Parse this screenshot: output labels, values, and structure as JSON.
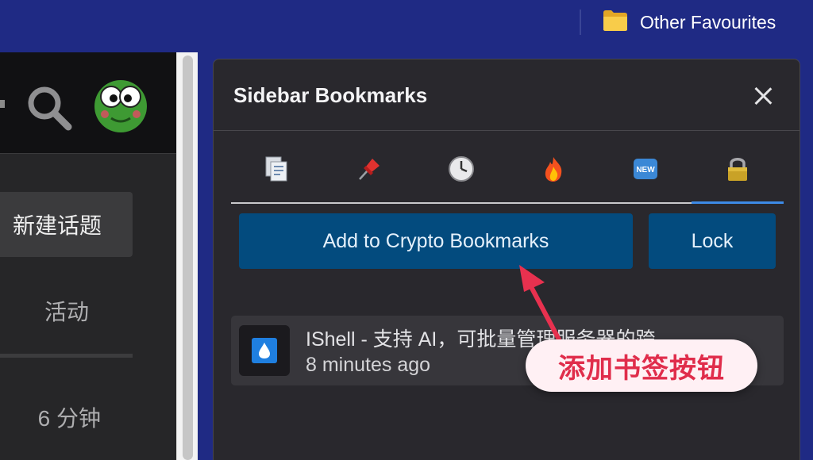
{
  "browser": {
    "favourites_bar": {
      "folder_label": "Other Favourites",
      "folder_icon": "folder-icon"
    }
  },
  "forum": {
    "header": {
      "search_icon": "search-icon",
      "avatar_icon": "frog-avatar"
    },
    "new_topic_label": "新建话题",
    "activity_label": "活动",
    "time_ago": "6 分钟"
  },
  "panel": {
    "title": "Sidebar Bookmarks",
    "close_icon": "close-icon",
    "tabs": [
      {
        "icon": "document-icon",
        "active": false
      },
      {
        "icon": "pushpin-icon",
        "active": false
      },
      {
        "icon": "clock-icon",
        "active": false
      },
      {
        "icon": "fire-icon",
        "active": false
      },
      {
        "icon": "new-badge-icon",
        "label": "NEW",
        "active": false
      },
      {
        "icon": "lock-icon",
        "active": true
      }
    ],
    "add_button_label": "Add to Crypto Bookmarks",
    "lock_button_label": "Lock",
    "bookmarks": [
      {
        "title": "IShell - 支持 AI，可批量管理服务器的跨",
        "time": "8 minutes ago",
        "icon": "droplet-icon"
      }
    ]
  },
  "annotation": {
    "text": "添加书签按钮",
    "color": "#e02d4b"
  },
  "colors": {
    "accent": "#034b7e",
    "tab_underline": "#3d8be8",
    "background": "#1f2a84"
  }
}
